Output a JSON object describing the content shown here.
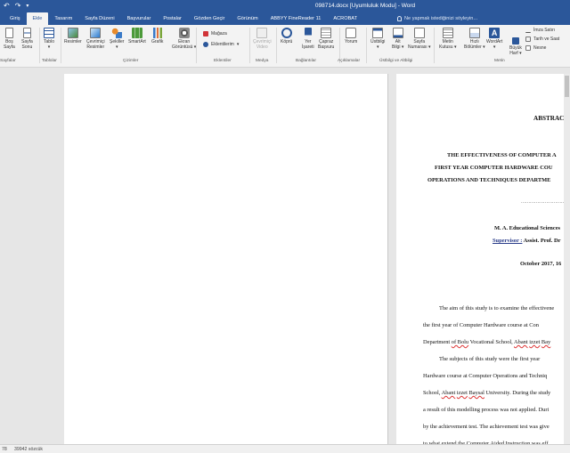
{
  "window": {
    "title": "098714.docx [Uyumluluk Modu] - Word"
  },
  "qat": {
    "undo_glyph": "↶",
    "redo_glyph": "↷",
    "dropdown_glyph": "▾"
  },
  "tabs": [
    "Giriş",
    "Ekle",
    "Tasarım",
    "Sayfa Düzeni",
    "Başvurular",
    "Postalar",
    "Gözden Geçir",
    "Görünüm",
    "ABBYY FineReader 11",
    "ACROBAT"
  ],
  "active_tab": "Ekle",
  "tell_me": {
    "icon": "lightbulb-icon",
    "placeholder": "Ne yapmak istediğinizi söyleyin..."
  },
  "ribbon": {
    "pages": {
      "cover_l1": "Boş",
      "cover_l2": "Sayfa",
      "break_l1": "Sayfa",
      "break_l2": "Sonu",
      "group": "Sayfalar"
    },
    "tables": {
      "table_l1": "Tablo",
      "table_l2": "▾",
      "group": "Tablolar"
    },
    "illustrations": {
      "pictures": "Resimler",
      "online_l1": "Çevrimiçi",
      "online_l2": "Resimler",
      "shapes_l1": "Şekiller",
      "shapes_l2": "▾",
      "smartart": "SmartArt",
      "chart": "Grafik",
      "screenshot_l1": "Ekran",
      "screenshot_l2": "Görüntüsü ▾",
      "group": "Çizimler"
    },
    "addins": {
      "store": "Mağaza",
      "my_addins": "Eklentilerim",
      "group": "Eklentiler"
    },
    "media": {
      "video_l1": "Çevrimiçi",
      "video_l2": "Video",
      "group": "Medya"
    },
    "links": {
      "link": "Köprü",
      "bookmark_l1": "Yer",
      "bookmark_l2": "İşareti",
      "crossref_l1": "Çapraz",
      "crossref_l2": "Başvuru",
      "group": "Bağlantılar"
    },
    "comments": {
      "comment": "Yorum",
      "group": "Açıklamalar"
    },
    "header_footer": {
      "header_l1": "Üstbilgi",
      "header_l2": "▾",
      "footer_l1": "Alt",
      "footer_l2": "Bilgi ▾",
      "pagenum_l1": "Sayfa",
      "pagenum_l2": "Numarası ▾",
      "group": "Üstbilgi ve Altbilgi"
    },
    "text": {
      "textbox_l1": "Metin",
      "textbox_l2": "Kutusu ▾",
      "quickparts_l1": "Hızlı",
      "quickparts_l2": "Bölümler ▾",
      "wordart_l1": "WordArt",
      "wordart_l2": "▾",
      "dropcap_l1": "Büyük",
      "dropcap_l2": "Harf ▾",
      "signature": "İmza Satırı",
      "datetime": "Tarih ve Saat",
      "object": "Nesne",
      "group": "Metin"
    }
  },
  "document": {
    "heading": "ABSTRACT",
    "title_lines": [
      "THE EFFECTIVENESS OF COMPUTER A",
      "FIRST YEAR COMPUTER HARDWARE COU",
      "OPERATIONS AND TECHNIQUES DEPARTME"
    ],
    "dots": "………………………………………………",
    "degree": "M. A. Educational Sciences",
    "supervisor_label": "Supervisor :",
    "supervisor_value": " Assist. Prof. Dr",
    "date": "October 2017, 16",
    "paragraphs": [
      [
        "The aim of this study is to examine the effectivene"
      ],
      [
        "the first year of Computer Hardware course at Con"
      ],
      [
        "Department ",
        "of  Bolu",
        " Vocational School, ",
        "Abant",
        " ",
        "izzet",
        " ",
        "Bay"
      ],
      [
        "The subjects of this study were the first year"
      ],
      [
        "Hardware course at Computer Operations and Techniq"
      ],
      [
        "School, ",
        "Abant",
        " ",
        "izzet",
        " ",
        "Baysal",
        " University. During the study"
      ],
      [
        "a result of this modelling process was not applied. Duri"
      ],
      [
        "by the achievement test. The achievement test was give"
      ],
      [
        "to what extend the Computer Aided Instruction was eff"
      ],
      [
        "subjects  were divided  into two groups as the control gr"
      ]
    ]
  },
  "statusbar": {
    "page_info": "78",
    "word_count": "39942 sözcük"
  }
}
